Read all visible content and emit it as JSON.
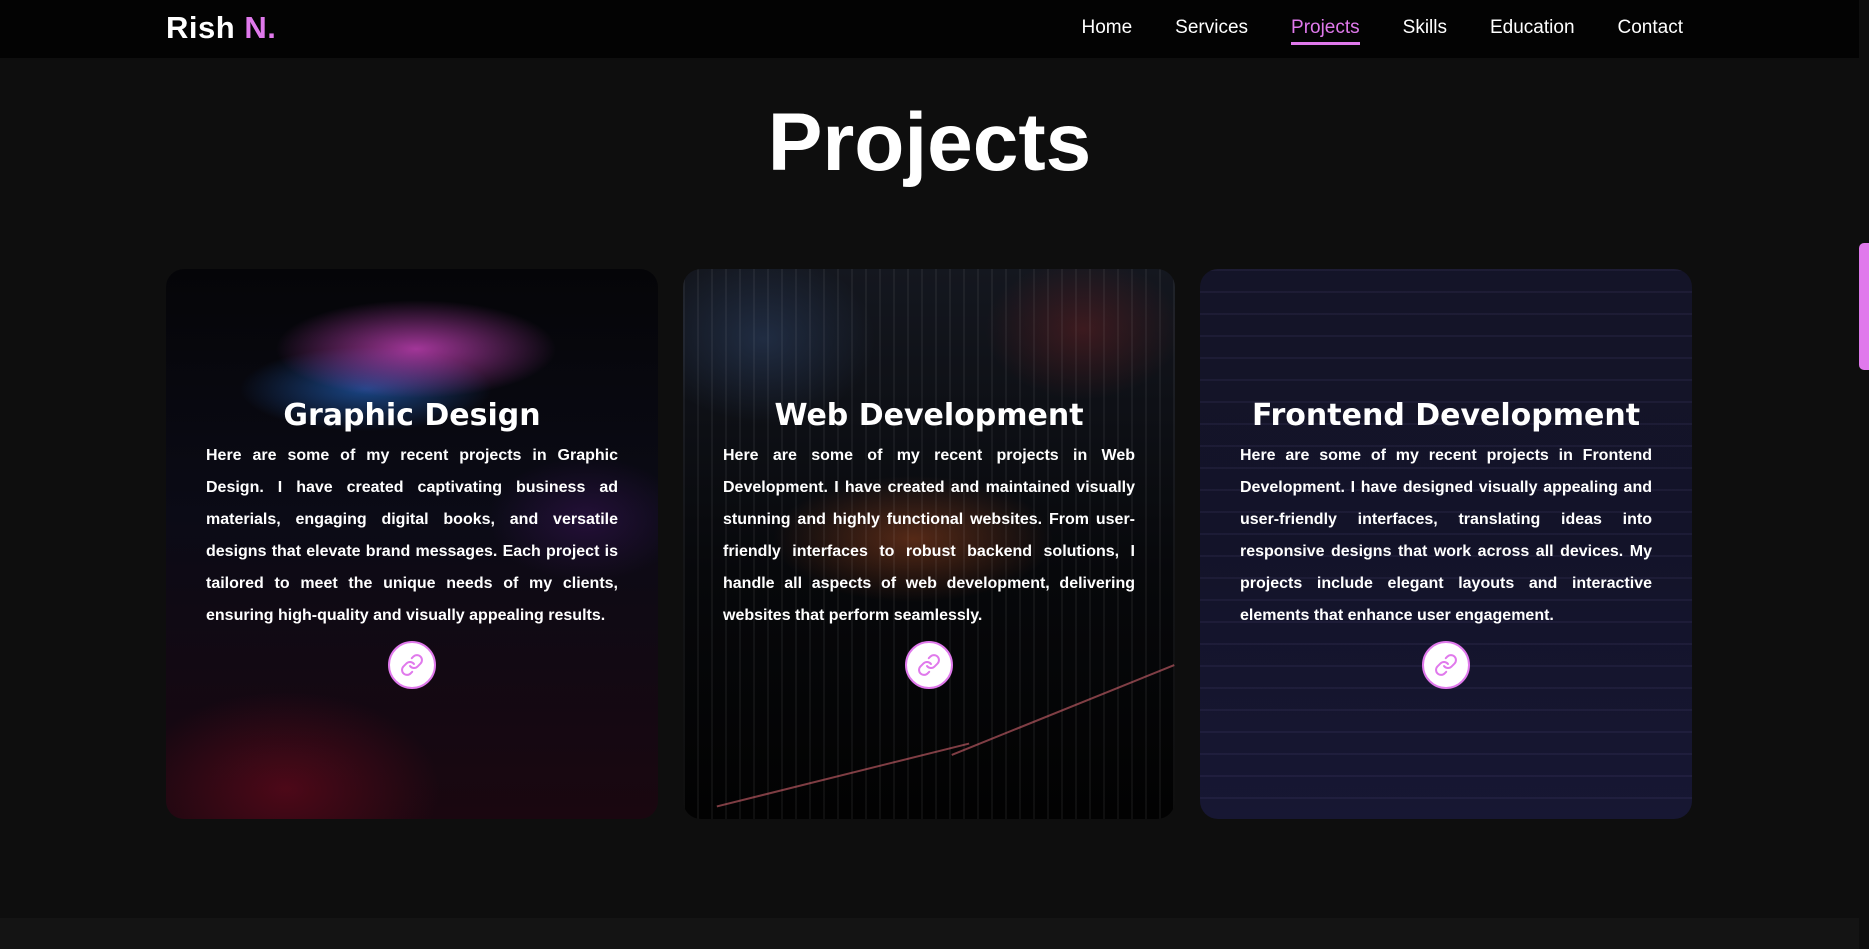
{
  "brand": {
    "name": "Rish",
    "accent": "N."
  },
  "nav": {
    "items": [
      {
        "label": "Home",
        "active": false
      },
      {
        "label": "Services",
        "active": false
      },
      {
        "label": "Projects",
        "active": true
      },
      {
        "label": "Skills",
        "active": false
      },
      {
        "label": "Education",
        "active": false
      },
      {
        "label": "Contact",
        "active": false
      }
    ]
  },
  "section": {
    "title": "Projects"
  },
  "cards": [
    {
      "title": "Graphic Design",
      "text": "Here are some of my recent projects in Graphic Design. I have created captivating business ad materials, engaging digital books, and versatile designs that elevate brand messages. Each project is tailored to meet the unique needs of my clients, ensuring high-quality and visually appealing results.",
      "icon": "link-icon"
    },
    {
      "title": "Web Development",
      "text": "Here are some of my recent projects in Web Development. I have created and maintained visually stunning and highly functional websites. From user-friendly interfaces to robust backend solutions, I handle all aspects of web development, delivering websites that perform seamlessly.",
      "icon": "link-icon"
    },
    {
      "title": "Frontend Development",
      "text": "Here are some of my recent projects in Frontend Development. I have designed visually appealing and user-friendly interfaces, translating ideas into responsive designs that work across all devices. My projects include elegant layouts and interactive elements that enhance user engagement.",
      "icon": "link-icon"
    }
  ],
  "colors": {
    "accent": "#e079ec",
    "background": "#0e0e0e",
    "navbar": "#030303"
  }
}
